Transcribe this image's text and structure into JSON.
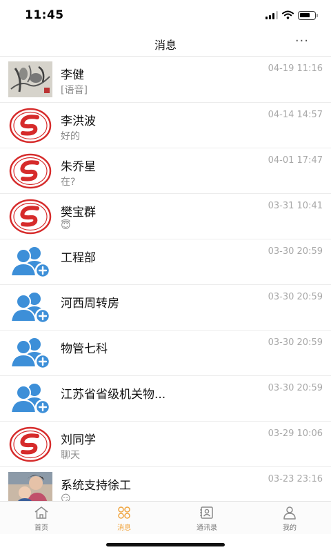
{
  "status_bar": {
    "time": "11:45",
    "icons": [
      "signal-icon",
      "wifi-icon",
      "battery-icon"
    ]
  },
  "header": {
    "title": "消息",
    "more_label": "···"
  },
  "colors": {
    "accent": "#f0a540",
    "group_blue": "#3d8fd8",
    "logo_red": "#d62b2b"
  },
  "chats": [
    {
      "avatar": "ink-painting-photo",
      "name": "李健",
      "preview": "[语音]",
      "time": "04-19 11:16"
    },
    {
      "avatar": "red-logo",
      "name": "李洪波",
      "preview": "好的",
      "time": "04-14 14:57"
    },
    {
      "avatar": "red-logo",
      "name": "朱乔星",
      "preview": "在?",
      "time": "04-01 17:47"
    },
    {
      "avatar": "red-logo",
      "name": "樊宝群",
      "preview": "😇",
      "time": "03-31 10:41"
    },
    {
      "avatar": "group-icon",
      "name": "工程部",
      "preview": "",
      "time": "03-30 20:59"
    },
    {
      "avatar": "group-icon",
      "name": "河西周转房",
      "preview": "",
      "time": "03-30 20:59"
    },
    {
      "avatar": "group-icon",
      "name": "物管七科",
      "preview": "",
      "time": "03-30 20:59"
    },
    {
      "avatar": "group-icon",
      "name": "江苏省省级机关物...",
      "preview": "",
      "time": "03-30 20:59"
    },
    {
      "avatar": "red-logo",
      "name": "刘同学",
      "preview": "聊天",
      "time": "03-29 10:06"
    },
    {
      "avatar": "family-photo",
      "name": "系统支持徐工",
      "preview": "😏",
      "time": "03-23 23:16"
    }
  ],
  "tabs": [
    {
      "label": "首页",
      "icon": "home-icon",
      "active": false
    },
    {
      "label": "消息",
      "icon": "message-grid-icon",
      "active": true
    },
    {
      "label": "通讯录",
      "icon": "contacts-icon",
      "active": false
    },
    {
      "label": "我的",
      "icon": "profile-icon",
      "active": false
    }
  ]
}
